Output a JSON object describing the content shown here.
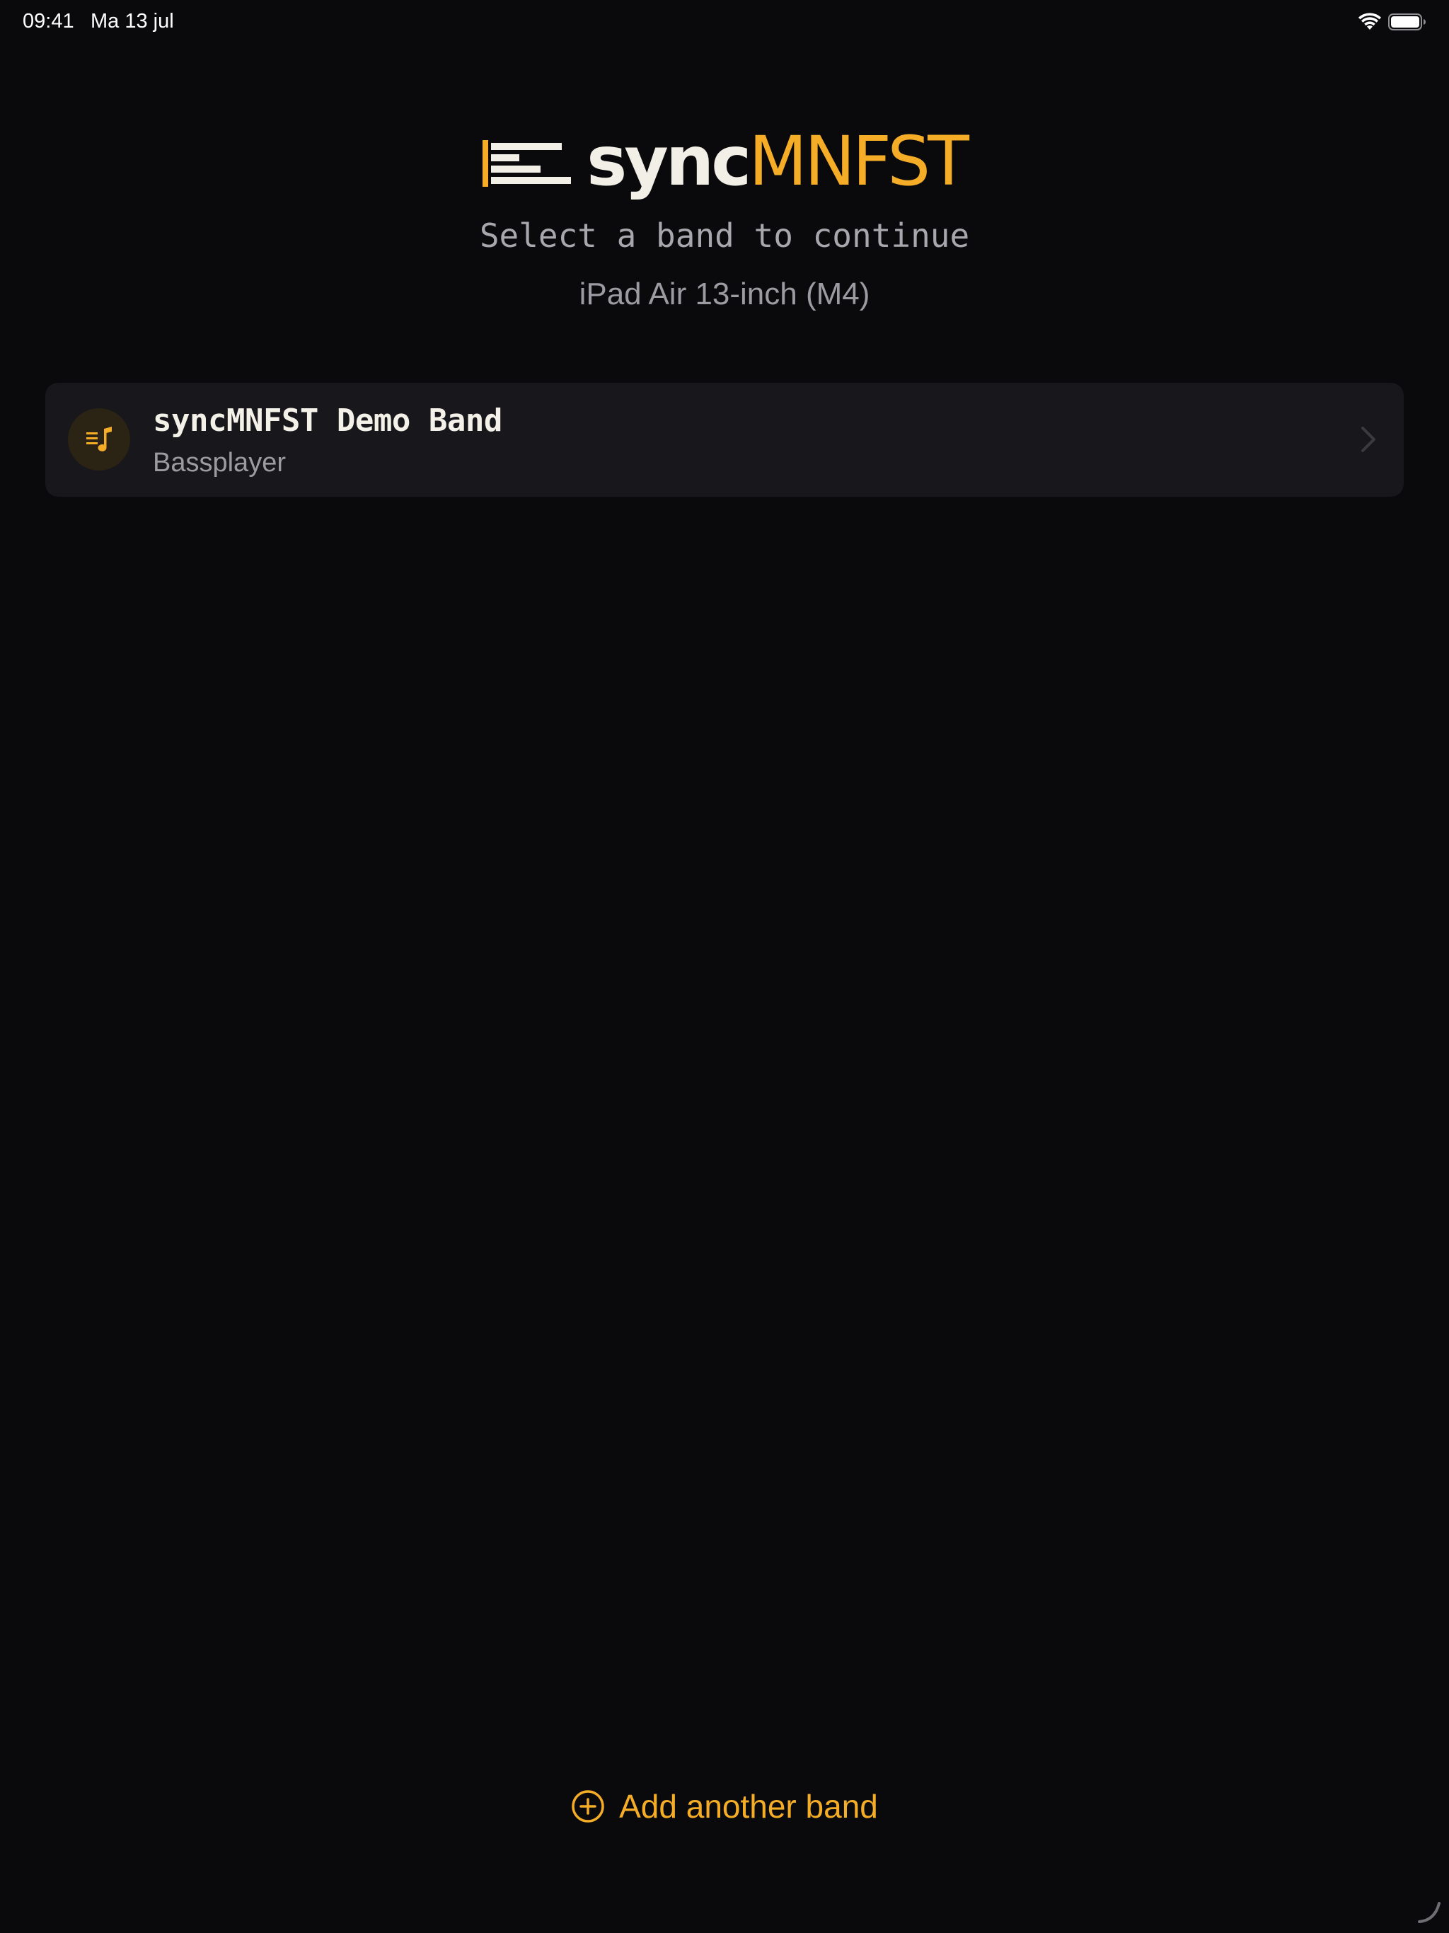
{
  "status_bar": {
    "time": "09:41",
    "date": "Ma 13 jul",
    "icons": [
      "wifi-icon",
      "battery-icon"
    ],
    "battery_level": 1.0
  },
  "logo": {
    "part1": "sync",
    "part2": "MNFST"
  },
  "header": {
    "subtitle": "Select a band to continue",
    "device": "iPad Air 13-inch (M4)"
  },
  "bands": [
    {
      "name": "syncMNFST Demo Band",
      "role": "Bassplayer",
      "icon": "music-list-icon"
    }
  ],
  "add_band": {
    "label": "Add another band",
    "icon": "plus-circle-icon"
  },
  "colors": {
    "background": "#0a0a0c",
    "accent": "#f5ad27",
    "card": "#17171c",
    "text_primary": "#f2efe6",
    "text_secondary": "#9b9ba1"
  }
}
